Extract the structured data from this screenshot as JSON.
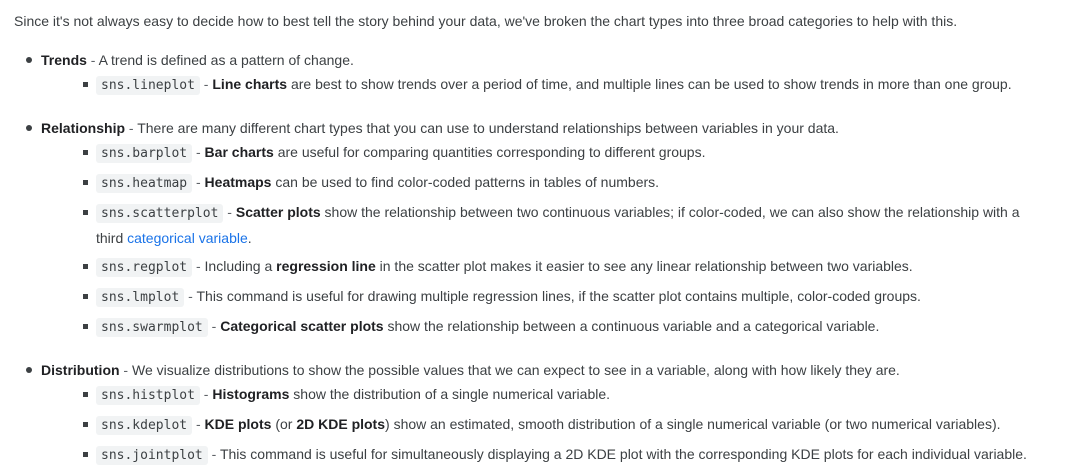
{
  "intro": "Since it's not always easy to decide how to best tell the story behind your data, we've broken the chart types into three broad categories to help with this.",
  "sections": [
    {
      "title": "Trends",
      "desc": "A trend is defined as a pattern of change.",
      "items": [
        {
          "code": "sns.lineplot",
          "bold": "Line charts",
          "text": " are best to show trends over a period of time, and multiple lines can be used to show trends in more than one group."
        }
      ]
    },
    {
      "title": "Relationship",
      "desc": "There are many different chart types that you can use to understand relationships between variables in your data.",
      "items": [
        {
          "code": "sns.barplot",
          "bold": "Bar charts",
          "text": " are useful for comparing quantities corresponding to different groups."
        },
        {
          "code": "sns.heatmap",
          "bold": "Heatmaps",
          "text": " can be used to find color-coded patterns in tables of numbers."
        },
        {
          "code": "sns.scatterplot",
          "bold": "Scatter plots",
          "text": " show the relationship between two continuous variables; if color-coded, we can also show the relationship with a",
          "cont_prefix": "third ",
          "link": "categorical variable",
          "cont_suffix": "."
        },
        {
          "code": "sns.regplot",
          "pre": "Including a ",
          "bold": "regression line",
          "text": " in the scatter plot makes it easier to see any linear relationship between two variables."
        },
        {
          "code": "sns.lmplot",
          "text": "This command is useful for drawing multiple regression lines, if the scatter plot contains multiple, color-coded groups."
        },
        {
          "code": "sns.swarmplot",
          "bold": "Categorical scatter plots",
          "text": " show the relationship between a continuous variable and a categorical variable."
        }
      ]
    },
    {
      "title": "Distribution",
      "desc": "We visualize distributions to show the possible values that we can expect to see in a variable, along with how likely they are.",
      "items": [
        {
          "code": "sns.histplot",
          "bold": "Histograms",
          "text": " show the distribution of a single numerical variable."
        },
        {
          "code": "sns.kdeplot",
          "bold": "KDE plots",
          "text1": " (or ",
          "bold2": "2D KDE plots",
          "text": ") show an estimated, smooth distribution of a single numerical variable (or two numerical variables)."
        },
        {
          "code": "sns.jointplot",
          "text": "This command is useful for simultaneously displaying a 2D KDE plot with the corresponding KDE plots for each individual variable."
        }
      ]
    }
  ],
  "separator": " - "
}
